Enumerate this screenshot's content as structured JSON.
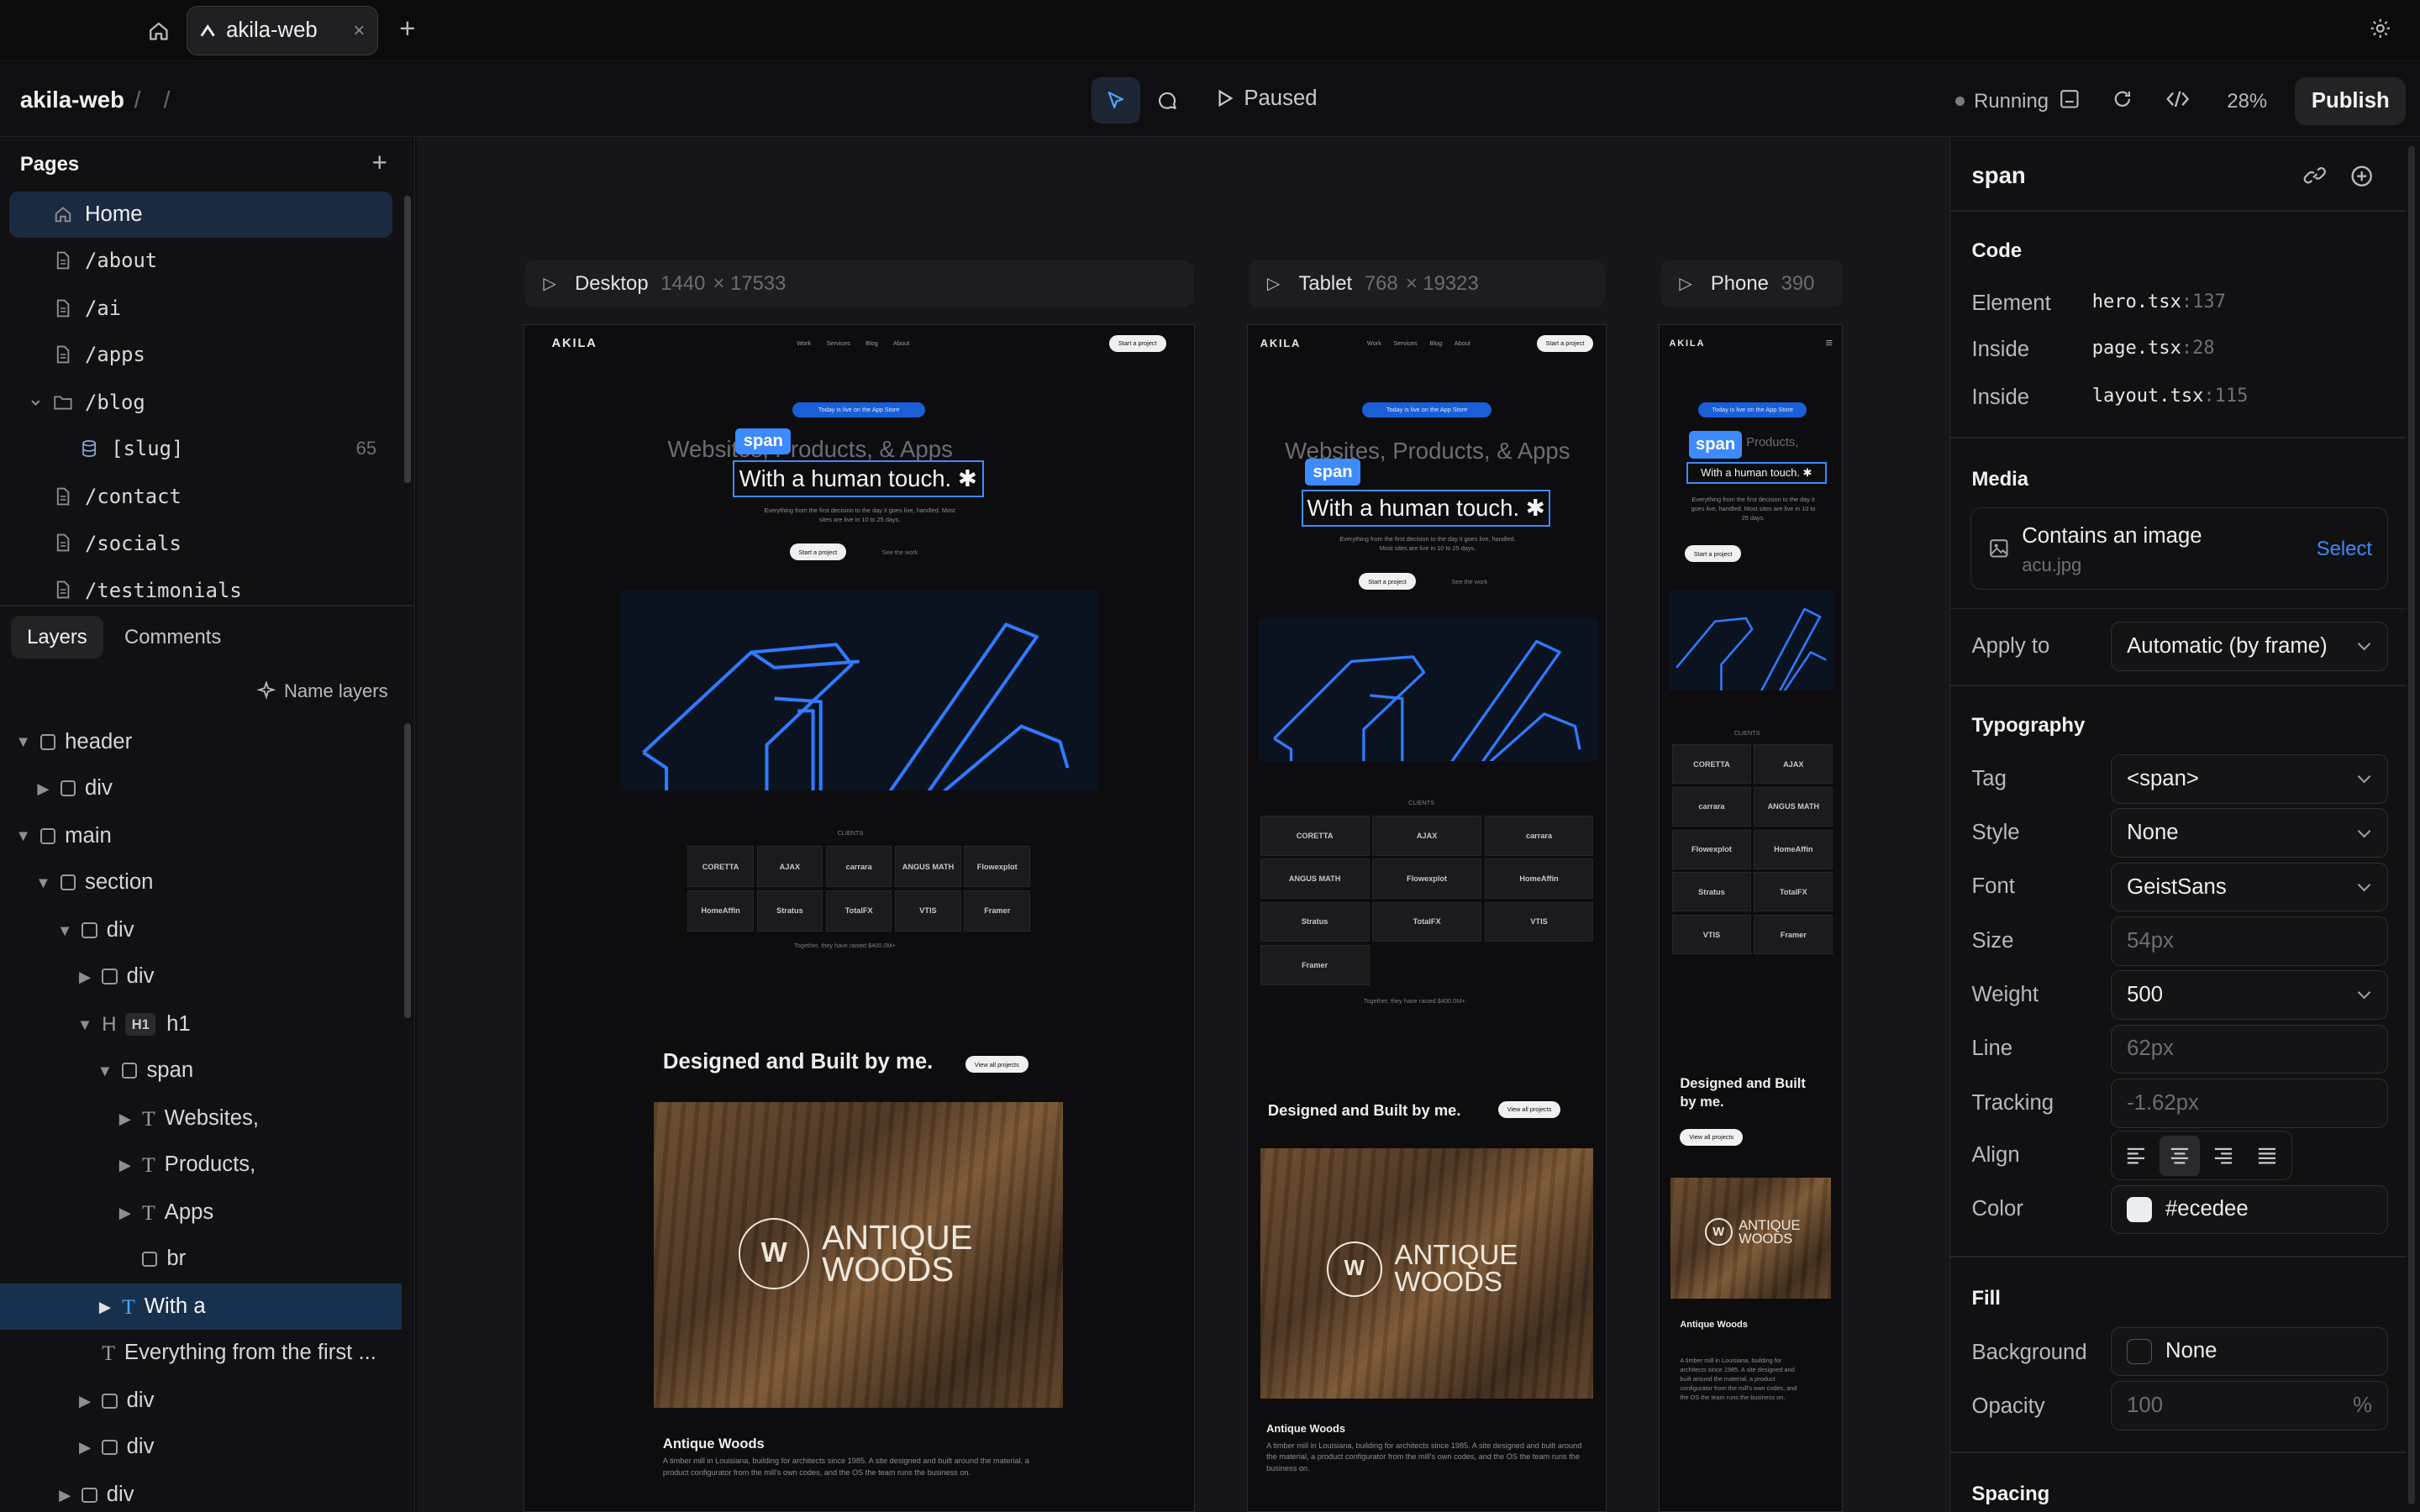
{
  "tabbar": {
    "tab_title": "akila-web",
    "close": "×",
    "new_tab": "+"
  },
  "toolbar": {
    "project": "akila-web",
    "sep1": "/",
    "sep2": "/",
    "paused": "Paused",
    "running": "Running",
    "zoom": "28%",
    "publish": "Publish"
  },
  "pages": {
    "header": "Pages",
    "items": [
      {
        "label": "Home"
      },
      {
        "label": "/about"
      },
      {
        "label": "/ai"
      },
      {
        "label": "/apps"
      },
      {
        "label": "/blog"
      },
      {
        "label": "[slug]",
        "count": "65"
      },
      {
        "label": "/contact"
      },
      {
        "label": "/socials"
      },
      {
        "label": "/testimonials"
      }
    ]
  },
  "layers_panel": {
    "tab_layers": "Layers",
    "tab_comments": "Comments",
    "name_layers": "Name layers",
    "badge_h1": "H1",
    "items": [
      "header",
      "div",
      "main",
      "section",
      "div",
      "div",
      "h1",
      "span",
      "Websites,",
      "Products,",
      "Apps",
      "br",
      "With a",
      "Everything from the first ...",
      "div",
      "div",
      "div"
    ]
  },
  "frames": {
    "desktop": {
      "name": "Desktop",
      "width": "1440",
      "height": "× 17533"
    },
    "tablet": {
      "name": "Tablet",
      "width": "768",
      "height": "× 19323"
    },
    "phone": {
      "name": "Phone",
      "width": "390"
    }
  },
  "site": {
    "logo": "AKILA",
    "nav": [
      "Work",
      "Services",
      "Blog",
      "About"
    ],
    "cta": "Start a project",
    "badge": "Today is live on the App Store",
    "hero_line1": "Websites, Products, & Apps",
    "hero_line2": "With a human touch. ✱",
    "span_label": "span",
    "hero_sub": "Everything from the first decision to the day it goes live, handled. Most sites are live in 10 to 25 days.",
    "btn_start": "Start a project",
    "btn_work": "See the work",
    "clients_label": "CLIENTS",
    "clients": [
      "CORETTA",
      "AJAX",
      "carrara",
      "ANGUS MATH",
      "Flowexplot",
      "HomeAffin",
      "Stratus",
      "TotalFX",
      "VTIS",
      "Framer"
    ],
    "clients_caption": "Together, they have raised $400.0M+",
    "designed": "Designed and Built by me.",
    "view_all": "View all projects",
    "project_name": "Antique Woods",
    "antique_l1": "ANTIQUE",
    "antique_l2": "WOODS",
    "project_desc": "A timber mill in Louisiana, building for architects since 1985. A site designed and built around the material, a product configurator from the mill's own codes, and the OS the team runs the business on."
  },
  "inspector": {
    "title": "span",
    "code_header": "Code",
    "code_rows": [
      {
        "label": "Element",
        "file": "hero.tsx",
        "line": ":137"
      },
      {
        "label": "Inside",
        "file": "page.tsx",
        "line": ":28"
      },
      {
        "label": "Inside",
        "file": "layout.tsx",
        "line": ":115"
      }
    ],
    "media_header": "Media",
    "media_title": "Contains an image",
    "media_file": "acu.jpg",
    "media_select": "Select",
    "apply_to_label": "Apply to",
    "apply_to_value": "Automatic (by frame)",
    "typography_header": "Typography",
    "tag_label": "Tag",
    "tag_value": "<span>",
    "style_label": "Style",
    "style_value": "None",
    "font_label": "Font",
    "font_value": "GeistSans",
    "size_label": "Size",
    "size_value": "54px",
    "weight_label": "Weight",
    "weight_value": "500",
    "line_label": "Line",
    "line_value": "62px",
    "tracking_label": "Tracking",
    "tracking_value": "-1.62px",
    "align_label": "Align",
    "color_label": "Color",
    "color_value": "#ecedee",
    "fill_header": "Fill",
    "background_label": "Background",
    "background_value": "None",
    "opacity_label": "Opacity",
    "opacity_value": "100",
    "opacity_unit": "%",
    "spacing_header": "Spacing"
  },
  "colors": {
    "accent": "#3d8bff",
    "selection": "#17304e",
    "text_color": "#ecedee"
  }
}
